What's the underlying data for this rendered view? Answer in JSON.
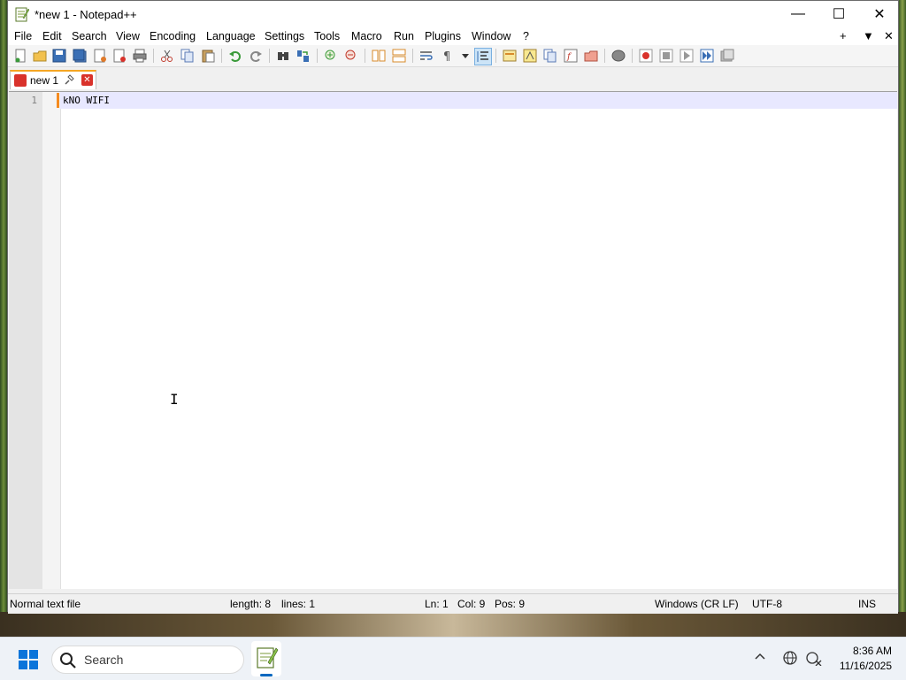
{
  "window": {
    "title": "*new 1 - Notepad++",
    "controls": {
      "minimize": "—",
      "maximize": "☐",
      "close": "✕"
    }
  },
  "menu": {
    "items": [
      "File",
      "Edit",
      "Search",
      "View",
      "Encoding",
      "Language",
      "Settings",
      "Tools",
      "Macro",
      "Run",
      "Plugins",
      "Window",
      "?"
    ],
    "right": {
      "add": "+",
      "dropdown": "▼",
      "close": "✕"
    }
  },
  "tab": {
    "label": "new 1",
    "pin": "📌",
    "close": "✕"
  },
  "editor": {
    "line_numbers": [
      "1"
    ],
    "lines": [
      "kNO WIFI"
    ],
    "cursor_glyph": "I"
  },
  "status": {
    "file_type": "Normal text file",
    "length": "length: 8",
    "lines": "lines: 1",
    "ln": "Ln: 1",
    "col": "Col: 9",
    "pos": "Pos: 9",
    "eol": "Windows (CR LF)",
    "encoding": "UTF-8",
    "mode": "INS"
  },
  "taskbar": {
    "search_placeholder": "Search",
    "tray_chevron": "^",
    "clock_time": "8:36 AM",
    "clock_date": "11/16/2025"
  },
  "colors": {
    "accent": "#0067c0",
    "tab_border": "#f5a623",
    "close_red": "#d9322b",
    "current_line": "#e8e8ff"
  }
}
